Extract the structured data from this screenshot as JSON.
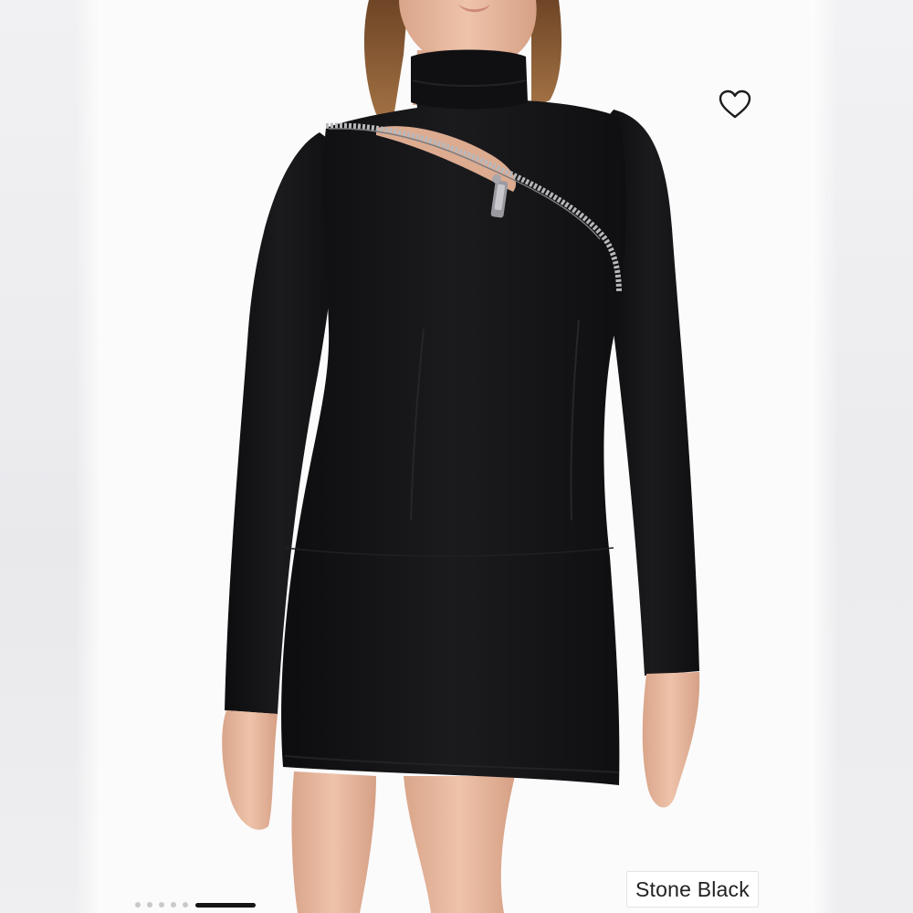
{
  "product": {
    "color_name": "Stone Black",
    "dress_color": "#141416",
    "zipper_color": "#b8b8bc",
    "skin_color": "#e7b9a0",
    "hair_color": "#8a5a34",
    "background_color": "#fbfbfc"
  },
  "favorite": {
    "icon": "heart-outline-icon",
    "selected": false
  },
  "gallery": {
    "image_count": 6,
    "current_index": 6,
    "active_color": "#151515",
    "inactive_color": "#c9c9cc"
  }
}
